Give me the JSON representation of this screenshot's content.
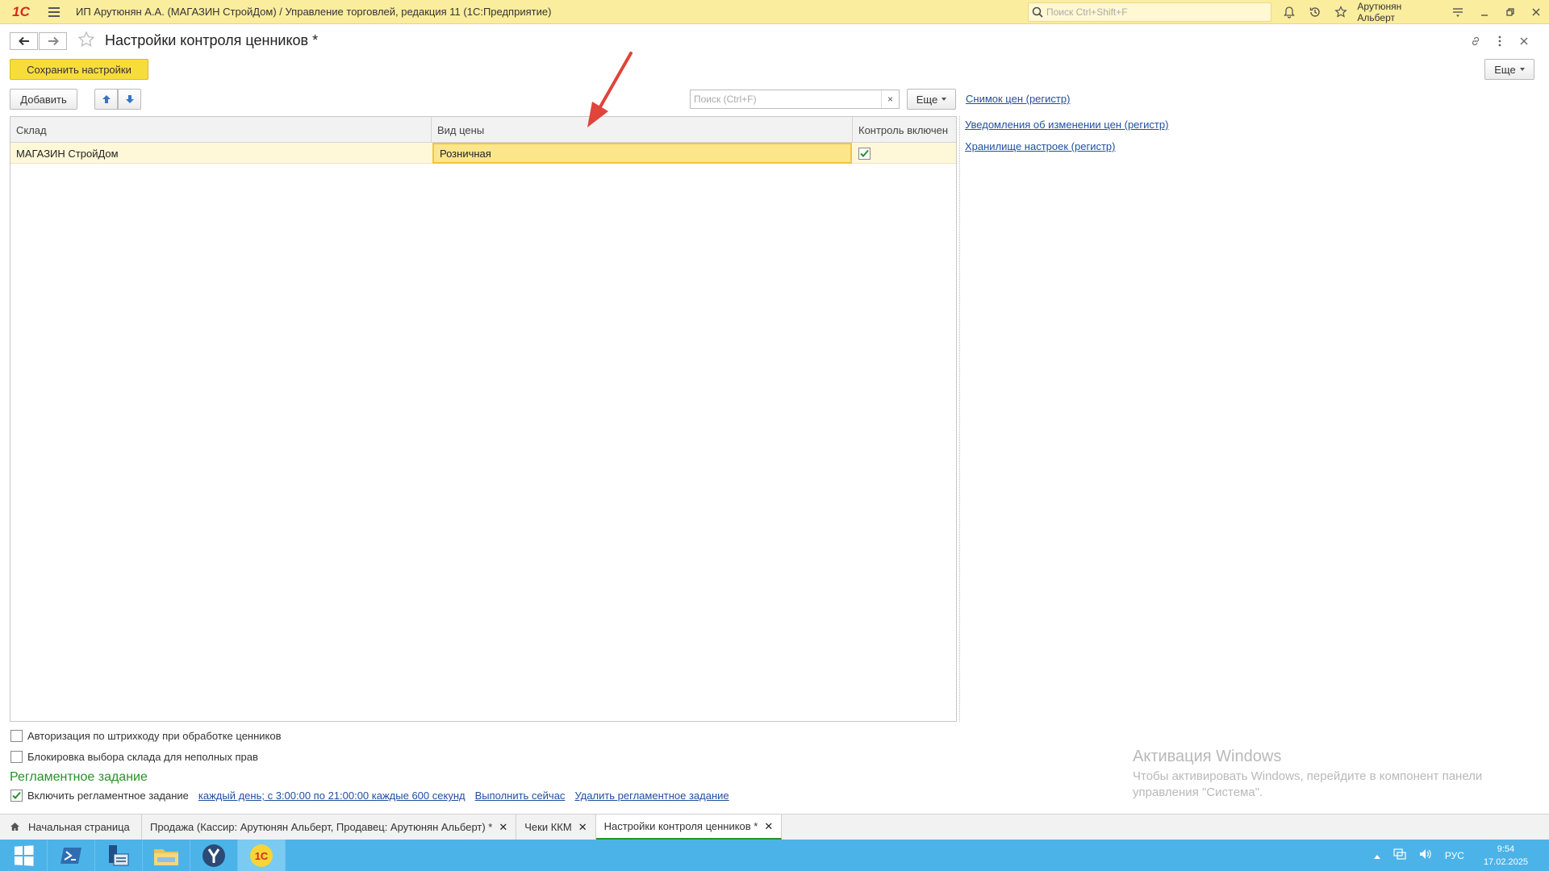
{
  "titlebar": {
    "logo": "1С",
    "title": "ИП Арутюнян А.А. (МАГАЗИН СтройДом) / Управление торговлей, редакция 11  (1С:Предприятие)",
    "search_placeholder": "Поиск Ctrl+Shift+F",
    "user": "Арутюнян Альберт"
  },
  "form": {
    "title": "Настройки контроля ценников *",
    "save_button": "Сохранить настройки",
    "more_top": "Еще",
    "add_button": "Добавить",
    "search_placeholder": "Поиск (Ctrl+F)",
    "search_clear": "×",
    "more_table": "Еще"
  },
  "table": {
    "columns": [
      "Склад",
      "Вид цены",
      "Контроль включен"
    ],
    "rows": [
      {
        "sklad": "МАГАЗИН СтройДом",
        "vid_ceny": "Розничная",
        "control_enabled": true
      }
    ]
  },
  "side_links": [
    "Снимок цен (регистр)",
    "Уведомления об изменении цен (регистр)",
    "Хранилище настроек (регистр)"
  ],
  "options": {
    "barcode_auth": {
      "label": "Авторизация по штрихкоду при обработке ценников",
      "checked": false
    },
    "block_warehouse": {
      "label": "Блокировка выбора склада для неполных прав",
      "checked": false
    }
  },
  "schedule": {
    "section_title": "Регламентное задание",
    "enable_label": "Включить регламентное задание",
    "enabled": true,
    "schedule_link": "каждый день; с 3:00:00 по 21:00:00 каждые 600 секунд",
    "run_now_link": "Выполнить сейчас",
    "delete_link": "Удалить регламентное задание"
  },
  "watermark": {
    "title": "Активация Windows",
    "text": "Чтобы активировать Windows, перейдите в компонент панели управления \"Система\"."
  },
  "tabs": [
    {
      "label": "Начальная страница",
      "closable": false
    },
    {
      "label": "Продажа (Кассир: Арутюнян Альберт, Продавец: Арутюнян Альберт) *",
      "closable": true
    },
    {
      "label": "Чеки ККМ",
      "closable": true
    },
    {
      "label": "Настройки контроля ценников *",
      "closable": true,
      "active": true
    }
  ],
  "taskbar": {
    "lang": "РУС",
    "time": "9:54",
    "date": "17.02.2025"
  }
}
